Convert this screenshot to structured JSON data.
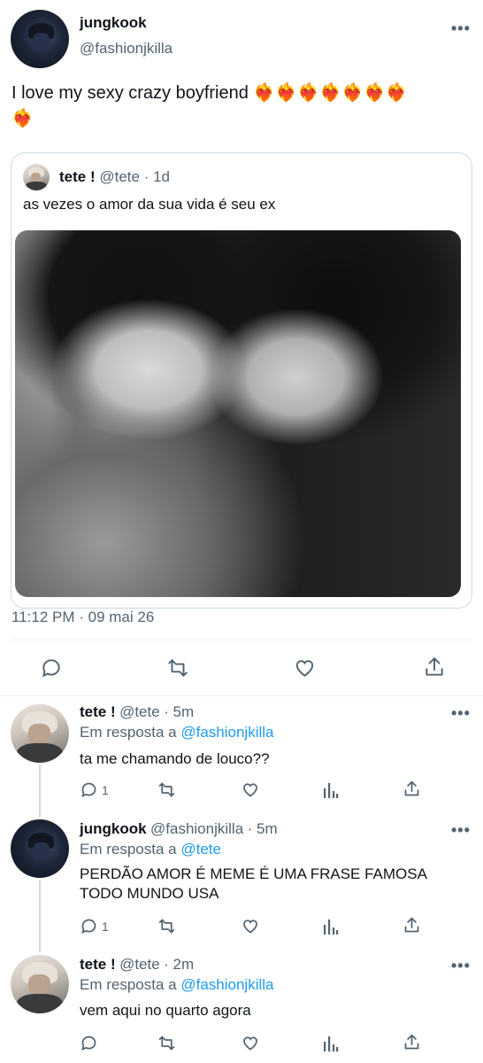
{
  "main_tweet": {
    "author_name": "jungkook",
    "author_handle": "@fashionjkilla",
    "more": "•••",
    "text_line1": "I love my sexy crazy boyfriend ❤️‍🔥❤️‍🔥❤️‍🔥❤️‍🔥❤️‍🔥❤️‍🔥❤️‍🔥",
    "text_line2": "❤️‍🔥",
    "timestamp": "11:12 PM · 09 mai 26"
  },
  "quoted_tweet": {
    "author_name": "tete !",
    "author_handle": "@tete",
    "time": "· 1d",
    "text": "as vezes o amor da sua vida é seu ex"
  },
  "replies": [
    {
      "author_name": "tete !",
      "author_handle": "@tete",
      "time": "· 5m",
      "reply_prefix": "Em resposta a",
      "reply_target": "@fashionjkilla",
      "text_line1": "ta me chamando de louco??",
      "text_line2": "",
      "reply_count": "1",
      "more": "•••"
    },
    {
      "author_name": "jungkook",
      "author_handle": "@fashionjkilla",
      "time": "· 5m",
      "reply_prefix": "Em resposta a",
      "reply_target": "@tete",
      "text_line1": "PERDÃO AMOR É MEME É UMA FRASE FAMOSA",
      "text_line2": "TODO MUNDO USA",
      "reply_count": "1",
      "more": "•••"
    },
    {
      "author_name": "tete !",
      "author_handle": "@tete",
      "time": "· 2m",
      "reply_prefix": "Em resposta a",
      "reply_target": "@fashionjkilla",
      "text_line1": "vem aqui no quarto agora",
      "text_line2": "",
      "reply_count": "",
      "more": "•••"
    }
  ],
  "colors": {
    "link": "#1d9bf0",
    "secondary_text": "#536471",
    "divider": "#eff3f4"
  },
  "icons": [
    "reply-icon",
    "retweet-icon",
    "like-icon",
    "share-icon",
    "analytics-icon",
    "more-icon"
  ]
}
